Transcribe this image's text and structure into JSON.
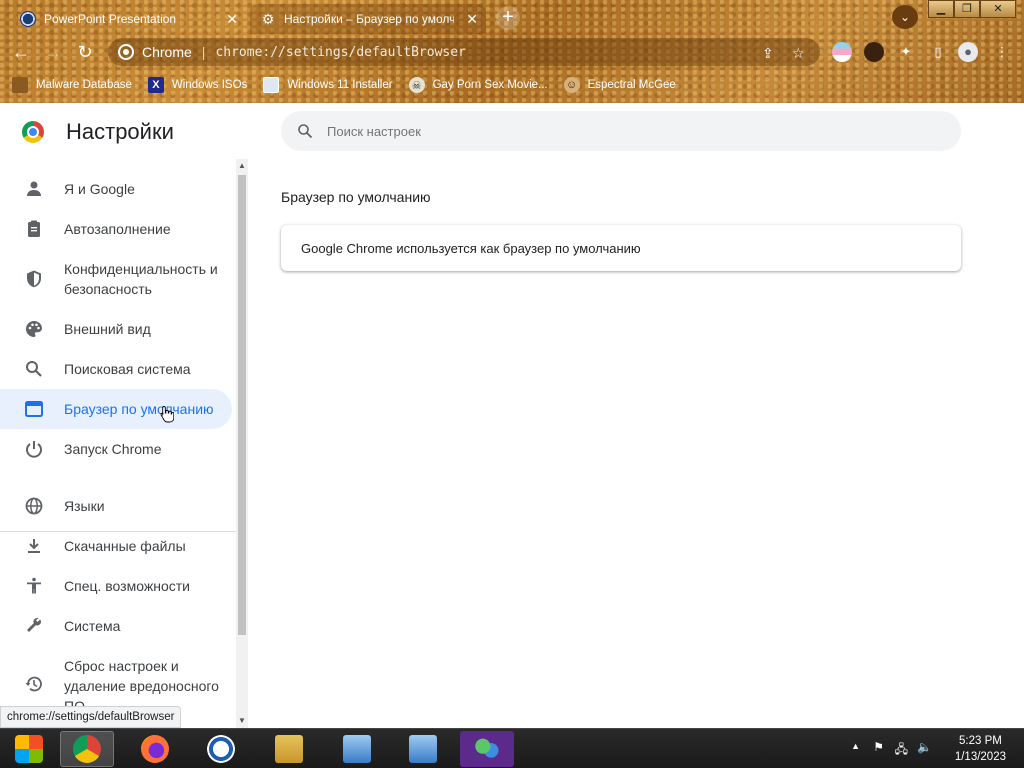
{
  "tabs": [
    {
      "title": "PowerPoint Presentation",
      "close": "✕"
    },
    {
      "title": "Настройки – Браузер по умолча",
      "close": "✕"
    }
  ],
  "new_tab_label": "+",
  "omnibox": {
    "scheme": "Chrome",
    "separator": "|",
    "url": "chrome://settings/defaultBrowser"
  },
  "bookmarks": [
    {
      "label": "Malware Database",
      "icon": "document-icon"
    },
    {
      "label": "Windows ISOs",
      "icon": "x-logo-icon"
    },
    {
      "label": "Windows 11 Installer",
      "icon": "image-icon"
    },
    {
      "label": "Gay Porn Sex Movie...",
      "icon": "skull-icon"
    },
    {
      "label": "Espectral McGee",
      "icon": "face-icon"
    }
  ],
  "settings": {
    "title": "Настройки",
    "search_placeholder": "Поиск настроек",
    "nav": [
      {
        "label": "Я и Google",
        "icon": "person-icon"
      },
      {
        "label": "Автозаполнение",
        "icon": "clipboard-icon"
      },
      {
        "label": "Конфиденциальность и безопасность",
        "icon": "shield-icon"
      },
      {
        "label": "Внешний вид",
        "icon": "palette-icon"
      },
      {
        "label": "Поисковая система",
        "icon": "search-icon"
      },
      {
        "label": "Браузер по умолчанию",
        "icon": "browser-icon",
        "active": true
      },
      {
        "label": "Запуск Chrome",
        "icon": "power-icon"
      },
      {
        "label": "Языки",
        "icon": "globe-icon"
      },
      {
        "label": "Скачанные файлы",
        "icon": "download-icon"
      },
      {
        "label": "Спец. возможности",
        "icon": "accessibility-icon"
      },
      {
        "label": "Система",
        "icon": "wrench-icon"
      },
      {
        "label": "Сброс настроек и удаление вредоносного ПО",
        "icon": "restore-icon"
      }
    ],
    "section_title": "Браузер по умолчанию",
    "card_text": "Google Chrome используется как браузер по умолчанию"
  },
  "status_bar_url": "chrome://settings/defaultBrowser",
  "clock": {
    "time": "5:23 PM",
    "date": "1/13/2023"
  },
  "colors": {
    "accent": "#1a73e8",
    "active_bg": "#e8f0fe",
    "theme": "#b77a2b"
  }
}
